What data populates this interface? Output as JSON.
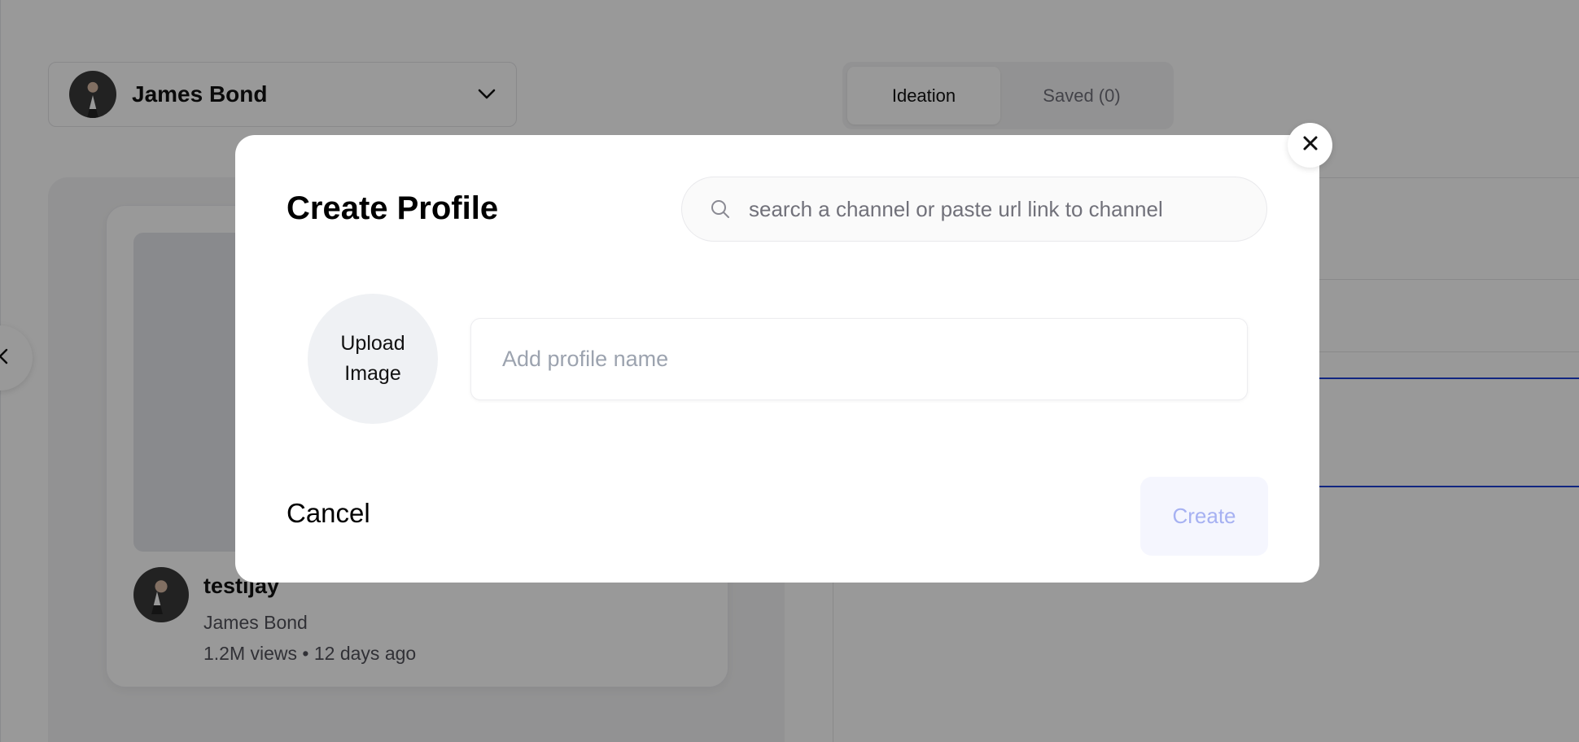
{
  "background": {
    "profile_selector": {
      "name": "James Bond",
      "avatar_icon": "person-avatar-icon",
      "chevron_icon": "chevron-down-icon"
    },
    "tabs": [
      {
        "label": "Ideation",
        "active": true
      },
      {
        "label": "Saved (0)",
        "active": false
      }
    ],
    "video_card": {
      "title": "testijay",
      "channel": "James Bond",
      "meta": "1.2M views • 12 days ago"
    },
    "prev_icon": "chevron-left-icon"
  },
  "modal": {
    "title": "Create Profile",
    "search": {
      "icon": "search-icon",
      "placeholder": "search a channel or paste url link to channel",
      "value": ""
    },
    "upload": {
      "line1": "Upload",
      "line2": "Image"
    },
    "profile_name": {
      "placeholder": "Add profile name",
      "value": ""
    },
    "cancel_label": "Cancel",
    "create_label": "Create",
    "close_icon": "close-icon"
  },
  "colors": {
    "overlay": "#00000066",
    "accent_disabled_text": "#a6b1f2",
    "accent_disabled_bg": "#f5f6fe",
    "accent_line": "#1d3fd8"
  }
}
